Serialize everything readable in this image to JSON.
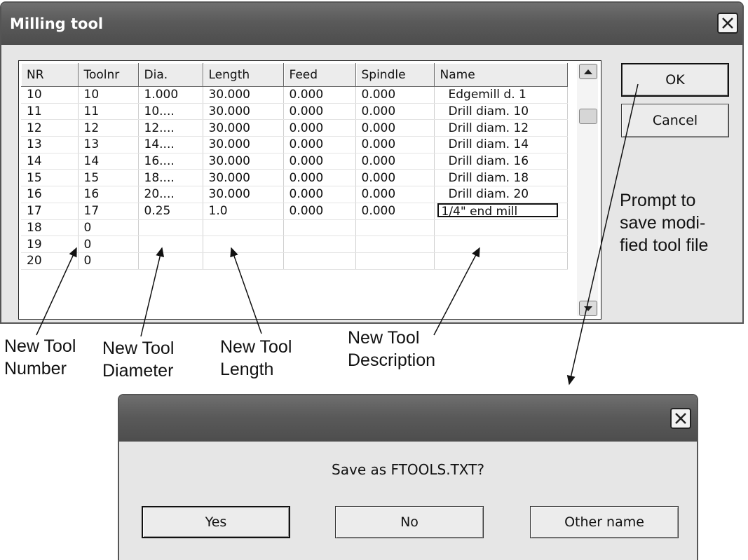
{
  "milling_dialog": {
    "title": "Milling tool",
    "columns": [
      "NR",
      "Toolnr",
      "Dia.",
      "Length",
      "Feed",
      "Spindle",
      "Name"
    ],
    "rows": [
      [
        "10",
        "10",
        "1.000",
        "30.000",
        "0.000",
        "0.000",
        "Edgemill d. 1"
      ],
      [
        "11",
        "11",
        "10....",
        "30.000",
        "0.000",
        "0.000",
        "Drill diam. 10"
      ],
      [
        "12",
        "12",
        "12....",
        "30.000",
        "0.000",
        "0.000",
        "Drill diam. 12"
      ],
      [
        "13",
        "13",
        "14....",
        "30.000",
        "0.000",
        "0.000",
        "Drill diam. 14"
      ],
      [
        "14",
        "14",
        "16....",
        "30.000",
        "0.000",
        "0.000",
        "Drill diam. 16"
      ],
      [
        "15",
        "15",
        "18....",
        "30.000",
        "0.000",
        "0.000",
        "Drill diam. 18"
      ],
      [
        "16",
        "16",
        "20....",
        "30.000",
        "0.000",
        "0.000",
        "Drill diam. 20"
      ],
      [
        "17",
        "17",
        "0.25",
        "1.0",
        "0.000",
        "0.000",
        "1/4\" end mill"
      ],
      [
        "18",
        "0",
        "",
        "",
        "",
        "",
        ""
      ],
      [
        "19",
        "0",
        "",
        "",
        "",
        "",
        ""
      ],
      [
        "20",
        "0",
        "",
        "",
        "",
        "",
        ""
      ]
    ],
    "ok_label": "OK",
    "cancel_label": "Cancel"
  },
  "save_dialog": {
    "message": "Save as FTOOLS.TXT?",
    "yes_label": "Yes",
    "no_label": "No",
    "other_label": "Other name"
  },
  "annotations": {
    "tool_number": [
      "New Tool",
      "Number"
    ],
    "tool_diameter": [
      "New Tool",
      "Diameter"
    ],
    "tool_length": [
      "New Tool",
      "Length"
    ],
    "tool_description": [
      "New Tool",
      "Description"
    ],
    "prompt": [
      "Prompt to",
      "save modi-",
      "fied tool file"
    ]
  },
  "icons": {
    "close": "close-icon",
    "scroll_up": "scroll-up-arrow-icon",
    "scroll_down": "scroll-down-arrow-icon"
  },
  "colors": {
    "titlebar": "#5a5a5a",
    "window_bg": "#e6e6e6"
  }
}
